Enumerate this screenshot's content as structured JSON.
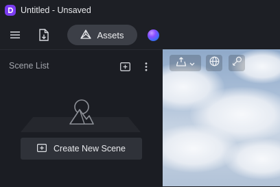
{
  "window": {
    "title": "Untitled - Unsaved",
    "logo_icon": "app-logo-icon",
    "accent": "#7b3cf0"
  },
  "toolbar": {
    "menu_icon": "hamburger-menu-icon",
    "file_icon": "file-import-icon",
    "assets_label": "Assets",
    "assets_icon": "assets-icon",
    "profile_icon": "gradient-orb-avatar"
  },
  "sidebar": {
    "title": "Scene List",
    "add_icon": "add-scene-icon",
    "more_icon": "more-vertical-icon",
    "empty_state_icon": "landscape-placeholder-icon",
    "create_button_label": "Create New Scene",
    "create_button_icon": "add-scene-icon"
  },
  "viewport": {
    "tools": [
      {
        "icon": "export-icon",
        "has_dropdown": true
      },
      {
        "icon": "globe-icon"
      },
      {
        "icon": "pin-tool-icon"
      }
    ],
    "background": "sky-with-clouds"
  }
}
